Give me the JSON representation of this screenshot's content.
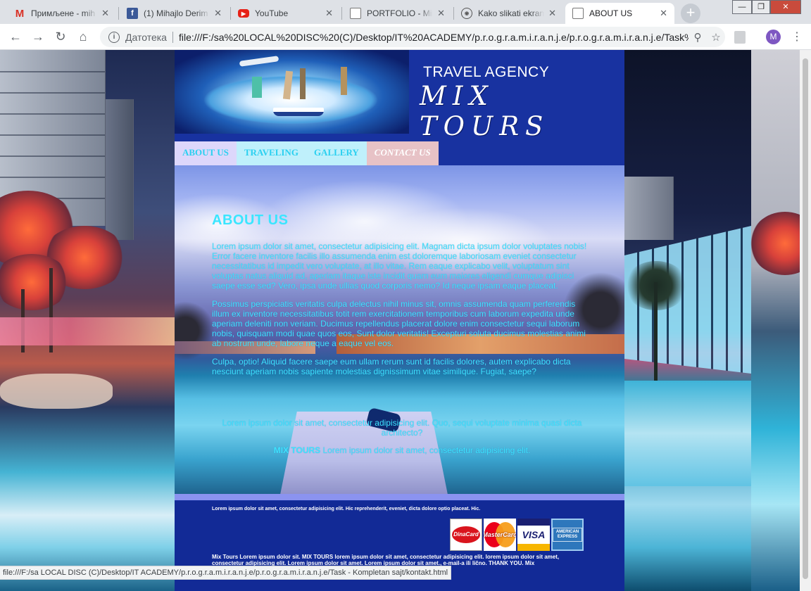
{
  "tabs": [
    {
      "icon": "gmail-icon",
      "title": "Примљене - mih"
    },
    {
      "icon": "facebook-icon",
      "title": "(1) Mihajlo Derim"
    },
    {
      "icon": "youtube-icon",
      "title": "YouTube"
    },
    {
      "icon": "page-icon",
      "title": "PORTFOLIO - Mih"
    },
    {
      "icon": "lightshot-icon",
      "title": "Kako slikati ekran"
    },
    {
      "icon": "page-icon",
      "title": "ABOUT US"
    }
  ],
  "window": {
    "minimize": "—",
    "restore": "❐",
    "close": "✕"
  },
  "address": {
    "label": "Датотека",
    "url": "file:///F:/sa%20LOCAL%20DISC%20(C)/Desktop/IT%20ACADEMY/p.r.o.g.r.a.m.i.r.a.n.j.e/p.r.o.g.r.a.m.i.r.a.n.j.e/Task%..."
  },
  "profile_initial": "M",
  "site": {
    "brand_top": "TRAVEL AGENCY",
    "brand_main": "MIX TOURS",
    "menu": [
      "ABOUT US",
      "TRAVELING",
      "GALLERY",
      "CONTACT US"
    ],
    "about": {
      "title": "ABOUT US",
      "p1": "Lorem ipsum dolor sit amet, consectetur adipisicing elit. Magnam dicta ipsum dolor voluptates nobis! Error facere inventore facilis illo assumenda enim est doloremque laboriosam eveniet consectetur necessitatibus id impedit vero voluptate, at illo vitae. Rem eaque explicabo velit, voluptatum sint voluptas natus aliquid ad, aperiam itaque iste incidit quam eum maiores eligendi cumque adipisci saepe esse sed? Vero, ipsa unde ullias quod corporis nemo? Id neque ipsam eaque placeat.",
      "p2": "Possimus perspiciatis veritatis culpa delectus nihil minus sit, omnis assumenda quam perferendis illum ex inventore necessitatibus totit rem exercitationem temporibus cum laborum expedita unde aperiam deleniti non veriam. Ducimus repellendus placerat dolore enim consectetur sequi laborum nobis, quisquam modi quae quos eos, Sunt dolor veritatis! Excepturi soluta ducimus molestias animi ab nostrum unde, labore neque a eaque vel eos.",
      "p3": "Culpa, optio! Aliquid facere saepe eum ullam rerum sunt id facilis dolores, autem explicabo dicta nesciunt aperiam nobis sapiente molestias dignissimum vitae similique. Fugiat, saepe?",
      "p4": "Lorem ipsum dolor sit amet, consectetur adipisicing elit. Quo, sequi voluptate minima quasi dicta architecto?",
      "p5_brand": "MIX TOURS",
      "p5_rest": " Lorem ipsum dolor sit amet, consectetur adipisicing elit."
    },
    "footer": {
      "line1": "Lorem ipsum dolor sit amet, consectetur adipisicing elit. Hic reprehenderit, eveniet, dicta dolore optio placeat. Hic.",
      "cards": [
        "DinaCard",
        "MasterCard",
        "VISA",
        "AMERICAN EXPRESS"
      ],
      "line2": "Mix Tours Lorem ipsum dolor sit. MIX TOURS lorem ipsum dolor sit amet, consectetur adipisicing elit. lorem ipsum dolor sit amet, consectetur adipisicing elit. Lorem ipsum dolor sit amet. Lorem ipsum dolor sit amet., e-mail-a ili lično. THANK YOU. Mix"
    }
  },
  "status_url": "file:///F:/sa LOCAL DISC (C)/Desktop/IT ACADEMY/p.r.o.g.r.a.m.i.r.a.n.j.e/p.r.o.g.r.a.m.i.r.a.n.j.e/Task - Kompletan sajt/kontakt.html",
  "colors": {
    "site_blue": "#1832a0",
    "accent_cyan": "#3ae6ff",
    "footer_blue": "#122a96"
  }
}
